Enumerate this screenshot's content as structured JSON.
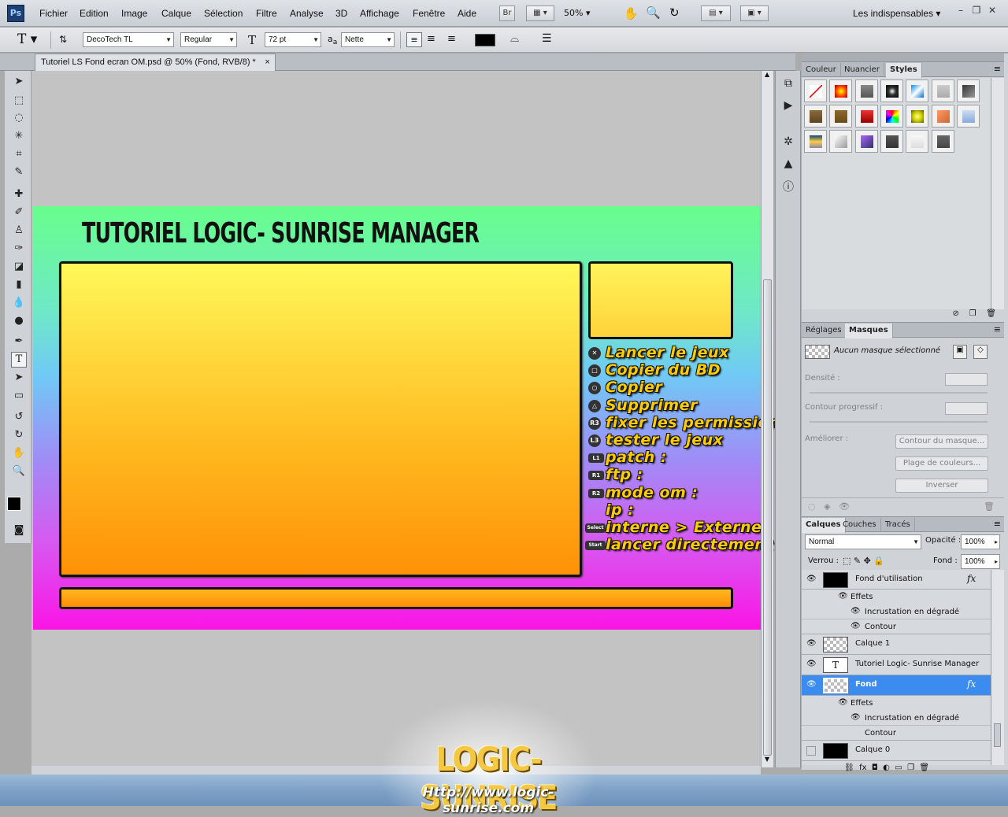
{
  "menubar": {
    "logo": "Ps",
    "items": [
      "Fichier",
      "Edition",
      "Image",
      "Calque",
      "Sélection",
      "Filtre",
      "Analyse",
      "3D",
      "Affichage",
      "Fenêtre",
      "Aide"
    ],
    "bridge_label": "Br",
    "zoom": "50%",
    "workspace": "Les indispensables"
  },
  "options": {
    "tool_glyph": "T",
    "font_family": "DecoTech TL",
    "font_style": "Regular",
    "font_size": "72 pt",
    "aa_label": "a",
    "aa_mode": "Nette",
    "text_color": "#000000"
  },
  "document": {
    "tab_title": "Tutoriel LS Fond ecran OM.psd @ 50% (Fond, RVB/8) *",
    "tab_close": "×",
    "heading": "TUTORIEL LOGIC- SUNRISE MANAGER",
    "buttons": [
      {
        "icon": "✕",
        "label": "Lancer le jeux",
        "kind": "round"
      },
      {
        "icon": "□",
        "label": "Copier du BD",
        "kind": "round"
      },
      {
        "icon": "○",
        "label": "Copier",
        "kind": "round"
      },
      {
        "icon": "△",
        "label": "Supprimer",
        "kind": "round"
      },
      {
        "icon": "R3",
        "label": "fixer les permissions",
        "kind": "round"
      },
      {
        "icon": "L3",
        "label": "tester le jeux",
        "kind": "round"
      },
      {
        "icon": "L1",
        "label": "patch :",
        "kind": "sq"
      },
      {
        "icon": "R1",
        "label": "ftp :",
        "kind": "sq"
      },
      {
        "icon": "R2",
        "label": "mode om :",
        "kind": "sq"
      },
      {
        "icon": "",
        "label": "ip :",
        "kind": "none"
      },
      {
        "icon": "Select",
        "label": "interne > Externe",
        "kind": "wide"
      },
      {
        "icon": "Start",
        "label": "lancer directement",
        "kind": "wide"
      }
    ]
  },
  "panels": {
    "styles_tabs": [
      "Couleur",
      "Nuancier",
      "Styles"
    ],
    "masks_tabs": [
      "Réglages",
      "Masques"
    ],
    "mask_status": "Aucun masque sélectionné",
    "density_label": "Densité :",
    "feather_label": "Contour progressif :",
    "improve_label": "Améliorer :",
    "btn_mask_edge": "Contour du masque...",
    "btn_color_range": "Plage de couleurs...",
    "btn_invert": "Inverser",
    "layers_tabs": [
      "Calques",
      "Couches",
      "Tracés"
    ],
    "blend_mode": "Normal",
    "opacity_label": "Opacité :",
    "opacity_value": "100%",
    "lock_label": "Verrou :",
    "fill_label": "Fond :",
    "fill_value": "100%",
    "layers": [
      {
        "name": "Fond d'utilisation",
        "fx": "fx",
        "effects_label": "Effets",
        "effects": [
          "Incrustation en dégradé",
          "Contour"
        ]
      },
      {
        "name": "Calque 1"
      },
      {
        "name": "Tutoriel Logic- Sunrise Manager",
        "type_glyph": "T"
      },
      {
        "name": "Fond",
        "fx": "fx",
        "effects_label": "Effets",
        "effects": [
          "Incrustation en dégradé",
          "Contour"
        ]
      },
      {
        "name": "Calque 0"
      }
    ]
  },
  "watermark": {
    "title": "LOGIC-SUNRISE",
    "url": "Http://www.logic-sunrise.com"
  },
  "colors": {
    "accent_selected": "#3c8cf0",
    "button_text": "#ffcc00"
  }
}
